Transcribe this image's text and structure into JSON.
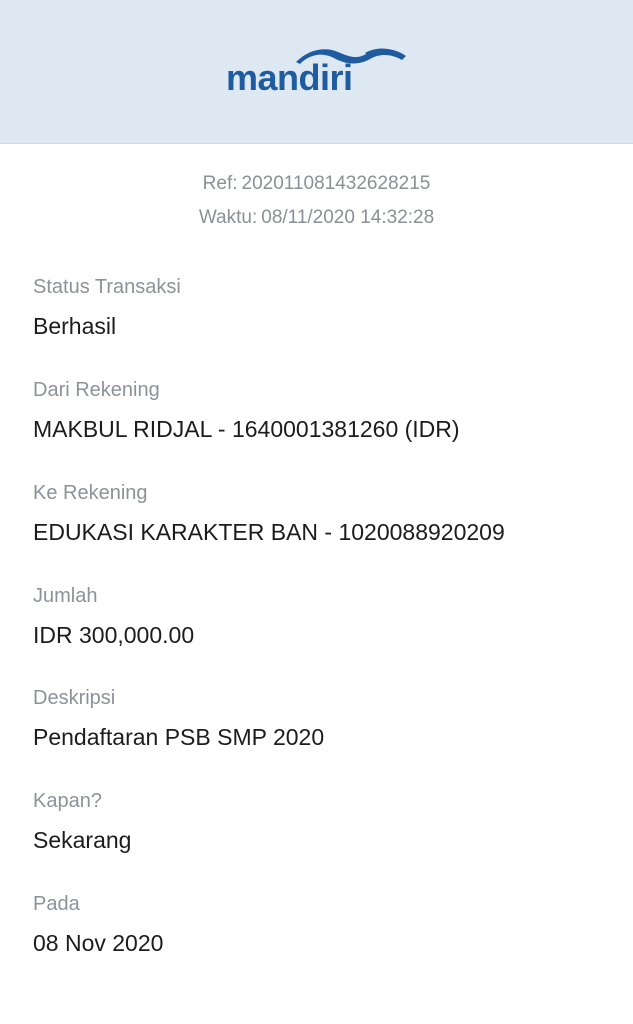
{
  "header": {
    "brand_name": "mandiri",
    "logo_icon": "mandiri-wave-logo",
    "brand_color": "#1f5b9f",
    "background_color": "#dde8f3"
  },
  "receipt": {
    "ref_label": "Ref:",
    "ref_value": "202011081432628215",
    "time_label": "Waktu:",
    "time_value": "08/11/2020 14:32:28"
  },
  "fields": [
    {
      "label": "Status Transaksi",
      "value": "Berhasil"
    },
    {
      "label": "Dari Rekening",
      "value": "MAKBUL RIDJAL - 1640001381260 (IDR)"
    },
    {
      "label": "Ke Rekening",
      "value": "EDUKASI KARAKTER BAN - 1020088920209"
    },
    {
      "label": "Jumlah",
      "value": "IDR 300,000.00"
    },
    {
      "label": "Deskripsi",
      "value": "Pendaftaran PSB SMP 2020"
    },
    {
      "label": "Kapan?",
      "value": "Sekarang"
    },
    {
      "label": "Pada",
      "value": "08 Nov 2020"
    }
  ]
}
